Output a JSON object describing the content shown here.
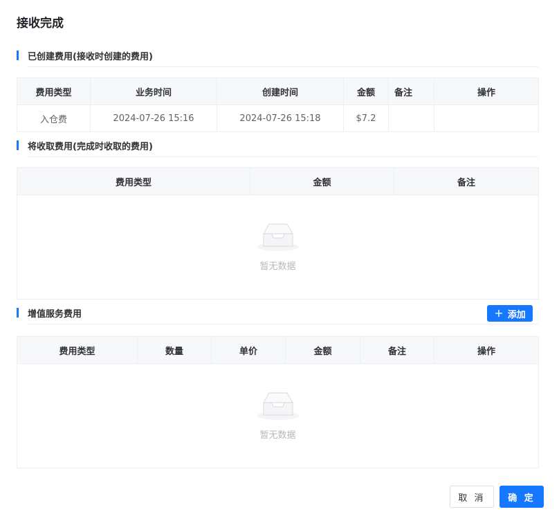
{
  "dialog": {
    "title": "接收完成"
  },
  "section_created": {
    "title": "已创建费用(接收时创建的费用)",
    "columns": [
      "费用类型",
      "业务时间",
      "创建时间",
      "金额",
      "备注",
      "操作"
    ],
    "rows": [
      [
        "入仓费",
        "2024-07-26 15:16",
        "2024-07-26 15:18",
        "$7.2",
        "",
        ""
      ]
    ]
  },
  "section_to_collect": {
    "title": "将收取费用(完成时收取的费用)",
    "columns": [
      "费用类型",
      "金额",
      "备注"
    ],
    "empty_text": "暂无数据"
  },
  "section_value_added": {
    "title": "增值服务费用",
    "add_button": "添加",
    "columns": [
      "费用类型",
      "数量",
      "单价",
      "金额",
      "备注",
      "操作"
    ],
    "empty_text": "暂无数据"
  },
  "footer": {
    "cancel_label": "取 消",
    "confirm_label": "确 定"
  },
  "colors": {
    "accent": "#1677ff",
    "border": "#ebeef5",
    "header_bg": "#f7f8fa"
  }
}
